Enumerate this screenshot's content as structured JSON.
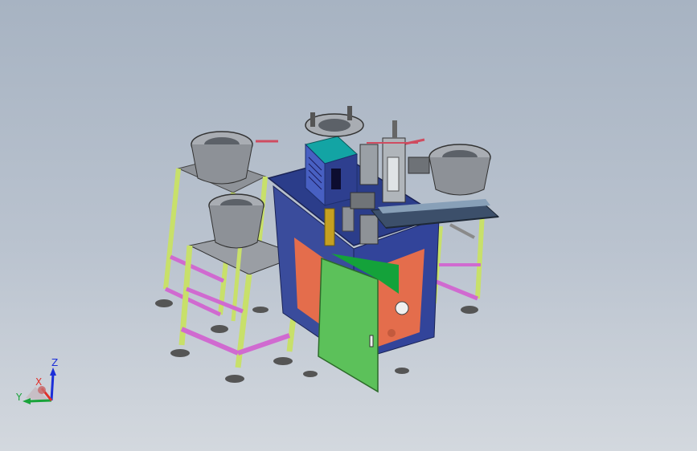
{
  "viewport": {
    "background_top": "#a7b3c2",
    "background_bottom": "#d3d8de"
  },
  "triad": {
    "x_label": "X",
    "y_label": "Y",
    "z_label": "Z",
    "x_color": "#e0302a",
    "y_color": "#19a33a",
    "z_color": "#1c2fd8"
  },
  "model": {
    "frame_color": "#c8e06a",
    "brace_color": "#d06ad0",
    "bowl_color": "#8b8f95",
    "table_color": "#2b3d8a",
    "panel_color": "#e46d4c",
    "door_color": "#5cc15a",
    "cabinet_color": "#0d9f9f"
  }
}
